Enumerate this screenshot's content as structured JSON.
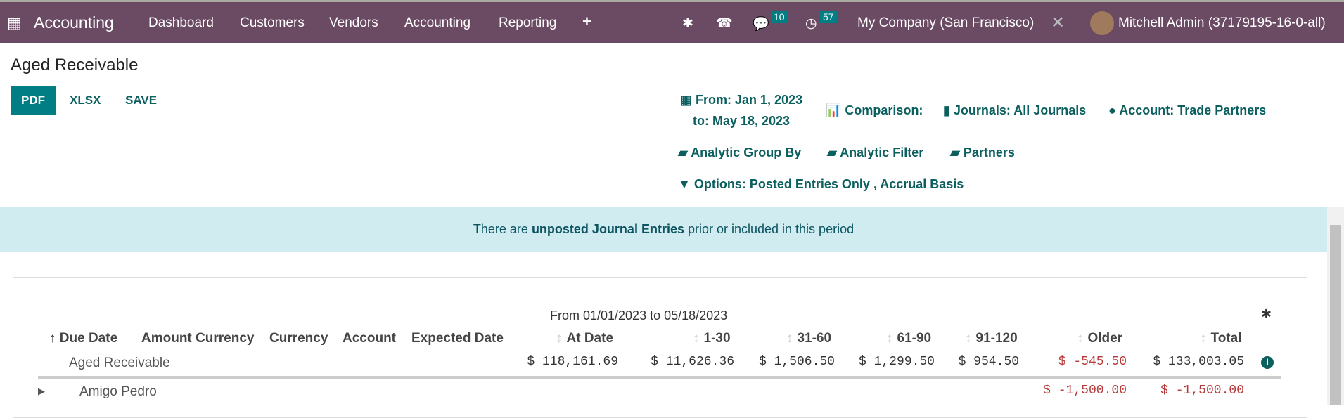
{
  "nav": {
    "app": "Accounting",
    "menu": [
      "Dashboard",
      "Customers",
      "Vendors",
      "Accounting",
      "Reporting"
    ],
    "messages_count": "10",
    "activities_count": "57",
    "company": "My Company (San Francisco)",
    "user": "Mitchell Admin (37179195-16-0-all)"
  },
  "page": {
    "title": "Aged Receivable",
    "pdf": "PDF",
    "xlsx": "XLSX",
    "save": "SAVE"
  },
  "filters": {
    "date_from": "From: Jan 1, 2023",
    "date_to": "to: May 18, 2023",
    "comparison": "Comparison:",
    "journals": "Journals: All Journals",
    "account": "Account: Trade Partners",
    "analytic_group": "Analytic Group By",
    "analytic_filter": "Analytic Filter",
    "partners": "Partners",
    "options": "Options: Posted Entries Only , Accrual Basis"
  },
  "banner": {
    "pre": "There are ",
    "link": "unposted Journal Entries",
    "post": " prior or included in this period"
  },
  "report": {
    "period": "From 01/01/2023 to 05/18/2023",
    "columns": [
      "Due Date",
      "Amount Currency",
      "Currency",
      "Account",
      "Expected Date",
      "At Date",
      "1-30",
      "31-60",
      "61-90",
      "91-120",
      "Older",
      "Total"
    ],
    "total_row": {
      "label": "Aged Receivable",
      "at_date": "$ 118,161.69",
      "d1_30": "$ 11,626.36",
      "d31_60": "$ 1,506.50",
      "d61_90": "$ 1,299.50",
      "d91_120": "$ 954.50",
      "older": "$ -545.50",
      "total": "$ 133,003.05"
    },
    "rows": [
      {
        "label": "Amigo Pedro",
        "older": "$ -1,500.00",
        "total": "$ -1,500.00"
      }
    ]
  },
  "colors": {
    "navbar": "#6b4a63",
    "accent": "#017e84",
    "negative": "#b83b3b",
    "banner": "#d1ecf1"
  }
}
